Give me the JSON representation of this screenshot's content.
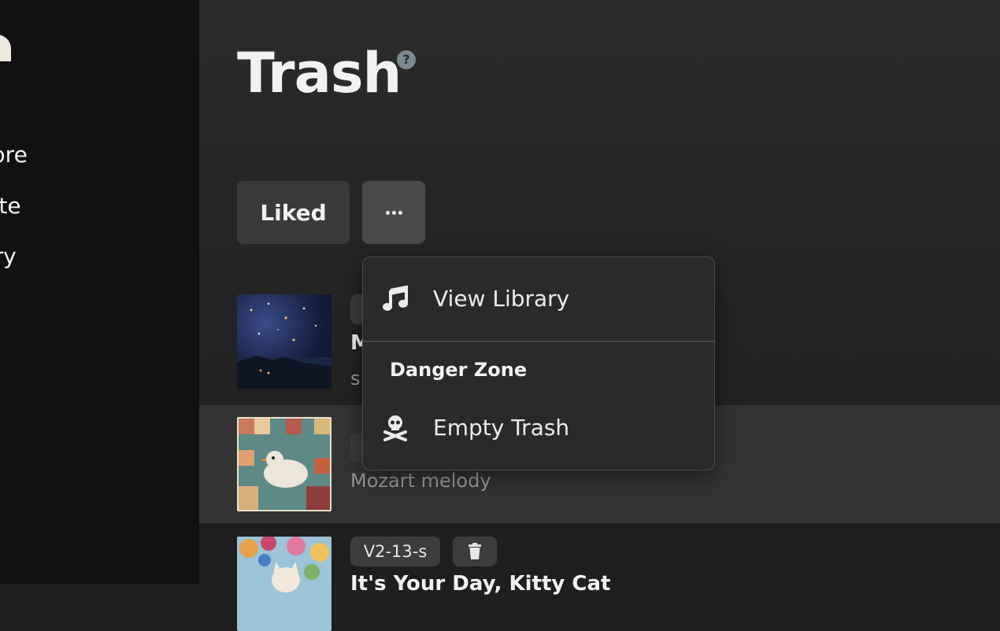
{
  "sidebar": {
    "items": [
      {
        "label": "plore"
      },
      {
        "label": "eate"
      },
      {
        "label": "rary"
      }
    ]
  },
  "header": {
    "title": "Trash",
    "help_icon": "help-icon",
    "help_glyph": "?"
  },
  "filters": {
    "liked_label": "Liked",
    "more_icon": "more-icon"
  },
  "menu": {
    "items": [
      {
        "label": "View Library",
        "icon": "music-note-icon"
      }
    ],
    "section_title": "Danger Zone",
    "danger_items": [
      {
        "label": "Empty Trash",
        "icon": "skull-crossbones-icon"
      }
    ]
  },
  "songs": [
    {
      "title": "M",
      "subtitle": "s"
    },
    {
      "title": "",
      "subtitle": "Mozart melody"
    },
    {
      "version": "V2-13-s",
      "title": "It's Your Day, Kitty Cat",
      "delete_icon": "trash-icon"
    }
  ],
  "colors": {
    "background": "#1f1f1f",
    "sidebar": "#111111",
    "accent_button": "#3a3a3a",
    "menu_bg": "#2a2a2a",
    "highlight_row": "#333333"
  }
}
